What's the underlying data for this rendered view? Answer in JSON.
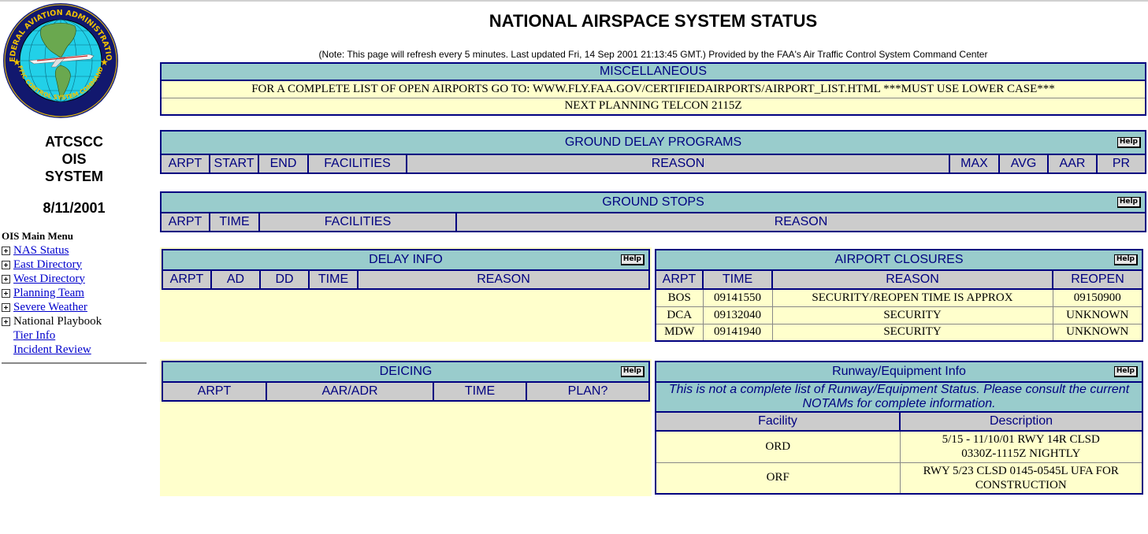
{
  "header": {
    "title": "NATIONAL AIRSPACE SYSTEM STATUS",
    "note": "(Note: This page will refresh every 5 minutes.  Last updated Fri, 14 Sep 2001 21:13:45 GMT.)   Provided by the FAA's Air Traffic Control System Command Center"
  },
  "sidebar": {
    "logo_top_text": "FEDERAL AVIATION ADMINISTRATION",
    "logo_bottom_text": "AIR TRAFFIC CONTROL SYSTEM COMMAND CENTER",
    "system_title_lines": [
      "ATCSCC",
      "OIS",
      "SYSTEM"
    ],
    "date": "8/11/2001",
    "menu_title": "OIS Main Menu",
    "menu_items": [
      {
        "label": "NAS Status",
        "expandable": true,
        "link": true
      },
      {
        "label": "East Directory",
        "expandable": true,
        "link": true
      },
      {
        "label": "West Directory",
        "expandable": true,
        "link": true
      },
      {
        "label": "Planning Team",
        "expandable": true,
        "link": true
      },
      {
        "label": "Severe Weather",
        "expandable": true,
        "link": true
      },
      {
        "label": "National Playbook",
        "expandable": true,
        "link": false
      },
      {
        "label": "Tier Info",
        "expandable": false,
        "link": true
      },
      {
        "label": "Incident Review",
        "expandable": false,
        "link": true
      }
    ]
  },
  "help_label": "Help",
  "miscellaneous": {
    "title": "MISCELLANEOUS",
    "rows": [
      "FOR A COMPLETE LIST OF OPEN AIRPORTS GO TO: WWW.FLY.FAA.GOV/CERTIFIEDAIRPORTS/AIRPORT_LIST.HTML ***MUST USE LOWER CASE***",
      "NEXT PLANNING TELCON 2115Z"
    ]
  },
  "ground_delay_programs": {
    "title": "GROUND DELAY PROGRAMS",
    "columns": [
      "ARPT",
      "START",
      "END",
      "FACILITIES",
      "REASON",
      "MAX",
      "AVG",
      "AAR",
      "PR"
    ],
    "rows": []
  },
  "ground_stops": {
    "title": "GROUND STOPS",
    "columns": [
      "ARPT",
      "TIME",
      "FACILITIES",
      "REASON"
    ],
    "rows": []
  },
  "delay_info": {
    "title": "DELAY INFO",
    "columns": [
      "ARPT",
      "AD",
      "DD",
      "TIME",
      "REASON"
    ],
    "rows": []
  },
  "airport_closures": {
    "title": "AIRPORT CLOSURES",
    "columns": [
      "ARPT",
      "TIME",
      "REASON",
      "REOPEN"
    ],
    "rows": [
      [
        "BOS",
        "09141550",
        "SECURITY/REOPEN TIME IS APPROX",
        "09150900"
      ],
      [
        "DCA",
        "09132040",
        "SECURITY",
        "UNKNOWN"
      ],
      [
        "MDW",
        "09141940",
        "SECURITY",
        "UNKNOWN"
      ]
    ]
  },
  "deicing": {
    "title": "DEICING",
    "columns": [
      "ARPT",
      "AAR/ADR",
      "TIME",
      "PLAN?"
    ],
    "rows": []
  },
  "runway_equipment": {
    "title": "Runway/Equipment Info",
    "notice": "This is not a complete list of Runway/Equipment Status. Please consult the current NOTAMs for complete information.",
    "columns": [
      "Facility",
      "Description"
    ],
    "rows": [
      [
        "ORD",
        "5/15 - 11/10/01 RWY 14R CLSD 0330Z-1115Z NIGHTLY"
      ],
      [
        "ORF",
        "RWY 5/23 CLSD 0145-0545L UFA FOR CONSTRUCTION"
      ]
    ]
  }
}
